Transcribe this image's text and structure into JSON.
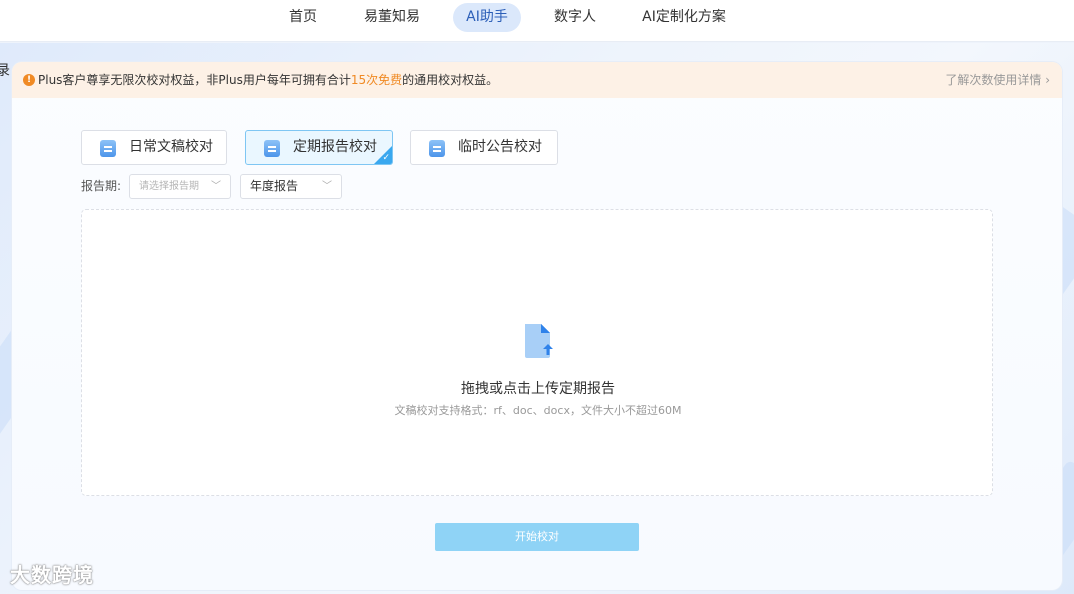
{
  "nav": {
    "items": [
      {
        "label": "首页",
        "active": false
      },
      {
        "label": "易董知易",
        "active": false
      },
      {
        "label": "AI助手",
        "active": true
      },
      {
        "label": "数字人",
        "active": false
      },
      {
        "label": "AI定制化方案",
        "active": false
      }
    ]
  },
  "left_clip_text": "录",
  "notice": {
    "icon": "exclamation-icon",
    "text_before": "Plus客户尊享无限次校对权益，非Plus用户每年可拥有合计",
    "highlight": "15次免费",
    "text_after": "的通用校对权益。",
    "link": "了解次数使用详情 ›",
    "highlight_color": "#f08a24"
  },
  "modes": [
    {
      "label": "日常文稿校对",
      "active": false
    },
    {
      "label": "定期报告校对",
      "active": true
    },
    {
      "label": "临时公告校对",
      "active": false
    }
  ],
  "period": {
    "label": "报告期:",
    "placeholder": "请选择报告期",
    "type_value": "年度报告"
  },
  "upload": {
    "title": "拖拽或点击上传定期报告",
    "hint": "文稿校对支持格式：rf、doc、docx，文件大小不超过60M"
  },
  "start_button": "开始校对",
  "watermark": "大数跨境",
  "colors": {
    "accent": "#3aa8ef",
    "start_button": "#8fd3f6",
    "nav_active_bg": "#dbe8fb"
  }
}
